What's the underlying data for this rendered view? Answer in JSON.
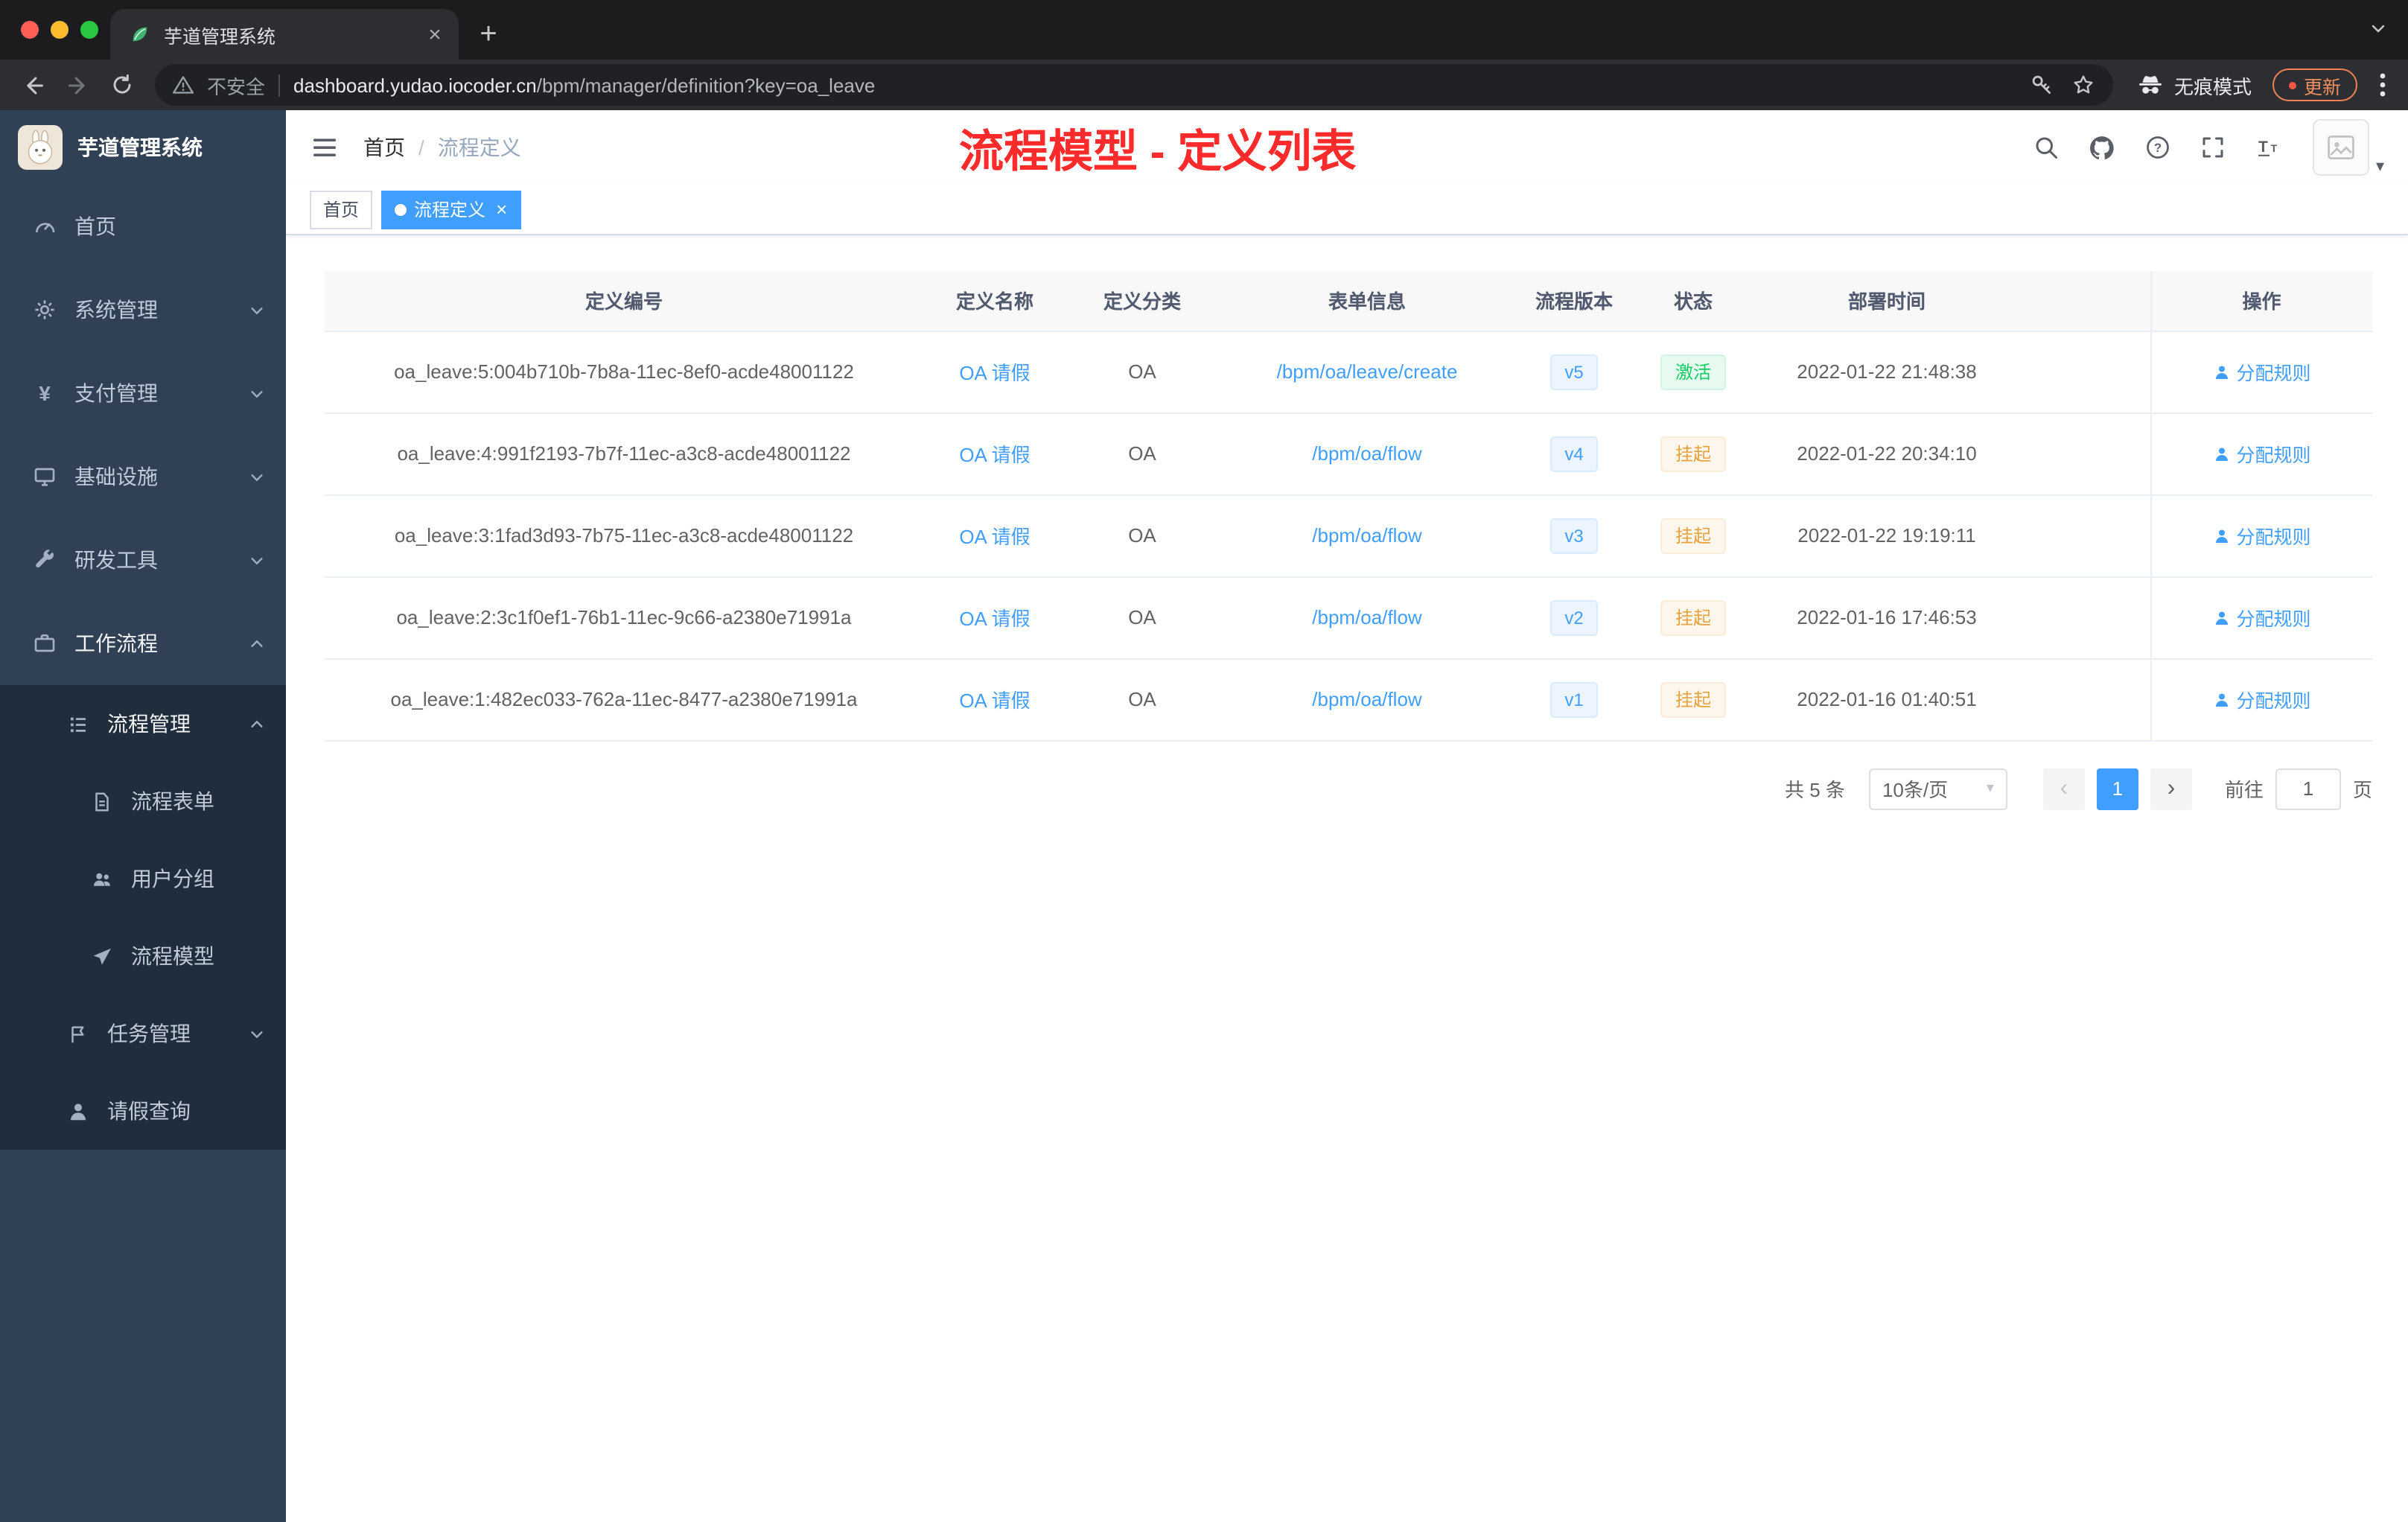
{
  "browser": {
    "tab_title": "芋道管理系统",
    "security_label": "不安全",
    "url_host": "dashboard.yudao.iocoder.cn",
    "url_path": "/bpm/manager/definition?key=oa_leave",
    "incognito_label": "无痕模式",
    "update_label": "更新"
  },
  "sidebar": {
    "logo_title": "芋道管理系统",
    "items": [
      {
        "label": "首页"
      },
      {
        "label": "系统管理"
      },
      {
        "label": "支付管理"
      },
      {
        "label": "基础设施"
      },
      {
        "label": "研发工具"
      },
      {
        "label": "工作流程"
      },
      {
        "label": "流程管理"
      },
      {
        "label": "流程表单"
      },
      {
        "label": "用户分组"
      },
      {
        "label": "流程模型"
      },
      {
        "label": "任务管理"
      },
      {
        "label": "请假查询"
      }
    ]
  },
  "navbar": {
    "breadcrumb_home": "首页",
    "breadcrumb_sep": "/",
    "breadcrumb_current": "流程定义",
    "annotation": "流程模型 - 定义列表"
  },
  "tags": {
    "home": "首页",
    "current": "流程定义",
    "close": "×"
  },
  "table": {
    "columns": [
      "定义编号",
      "定义名称",
      "定义分类",
      "表单信息",
      "流程版本",
      "状态",
      "部署时间",
      "操作"
    ],
    "action_label": "分配规则",
    "rows": [
      {
        "id": "oa_leave:5:004b710b-7b8a-11ec-8ef0-acde48001122",
        "name": "OA 请假",
        "category": "OA",
        "form": "/bpm/oa/leave/create",
        "version": "v5",
        "status": "激活",
        "time": "2022-01-22 21:48:38"
      },
      {
        "id": "oa_leave:4:991f2193-7b7f-11ec-a3c8-acde48001122",
        "name": "OA 请假",
        "category": "OA",
        "form": "/bpm/oa/flow",
        "version": "v4",
        "status": "挂起",
        "time": "2022-01-22 20:34:10"
      },
      {
        "id": "oa_leave:3:1fad3d93-7b75-11ec-a3c8-acde48001122",
        "name": "OA 请假",
        "category": "OA",
        "form": "/bpm/oa/flow",
        "version": "v3",
        "status": "挂起",
        "time": "2022-01-22 19:19:11"
      },
      {
        "id": "oa_leave:2:3c1f0ef1-76b1-11ec-9c66-a2380e71991a",
        "name": "OA 请假",
        "category": "OA",
        "form": "/bpm/oa/flow",
        "version": "v2",
        "status": "挂起",
        "time": "2022-01-16 17:46:53"
      },
      {
        "id": "oa_leave:1:482ec033-762a-11ec-8477-a2380e71991a",
        "name": "OA 请假",
        "category": "OA",
        "form": "/bpm/oa/flow",
        "version": "v1",
        "status": "挂起",
        "time": "2022-01-16 01:40:51"
      }
    ]
  },
  "pagination": {
    "total": "共 5 条",
    "page_size": "10条/页",
    "current_page": "1",
    "goto_label": "前往",
    "goto_value": "1",
    "page_label": "页"
  },
  "colors": {
    "accent_blue": "#409eff",
    "success_green": "#13ce66",
    "warning_orange": "#e6a23c",
    "annotation_red": "#fc2b2b",
    "sidebar_bg": "#304156",
    "submenu_bg": "#1f2d3d"
  }
}
